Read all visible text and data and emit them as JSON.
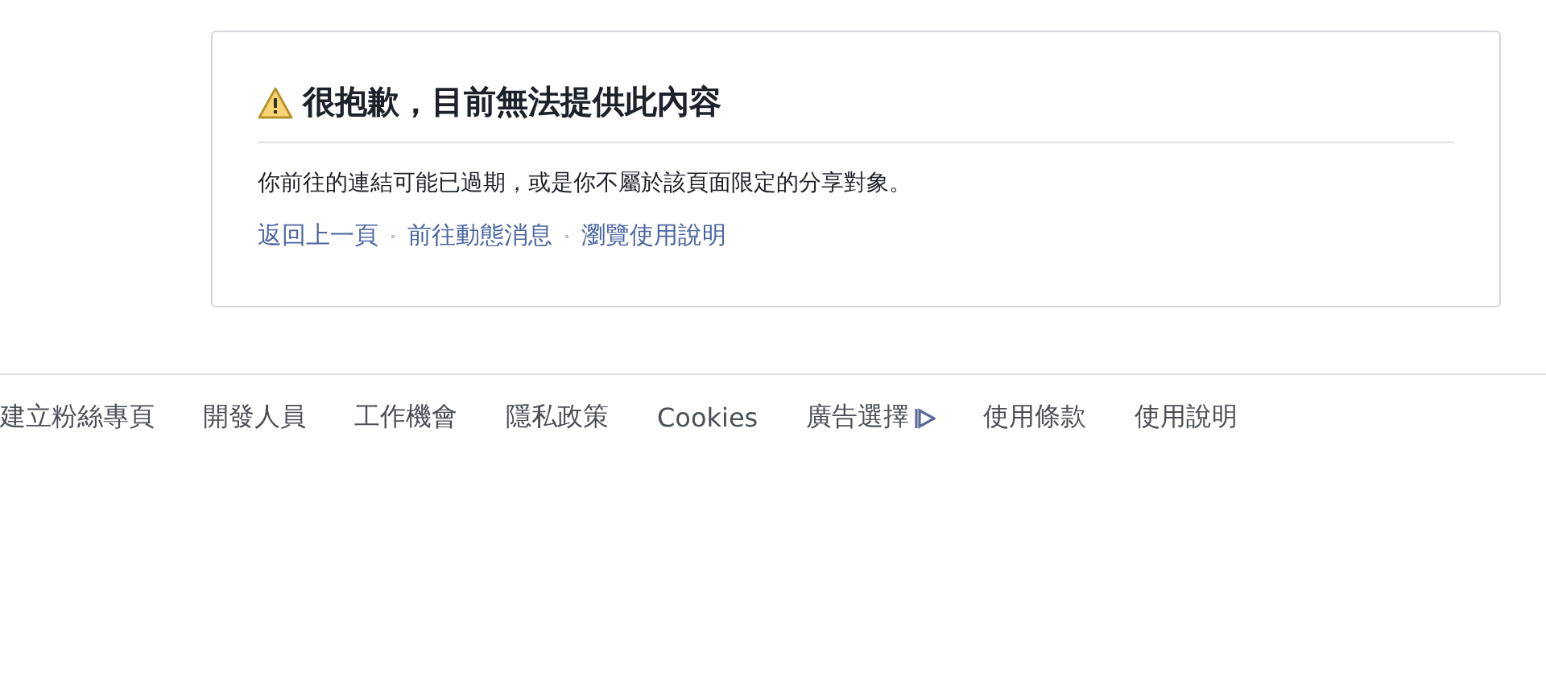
{
  "notice": {
    "title": "很抱歉，目前無法提供此內容",
    "message": "你前往的連結可能已過期，或是你不屬於該頁面限定的分享對象。",
    "links": [
      "返回上一頁",
      "前往動態消息",
      "瀏覽使用說明"
    ]
  },
  "footer": {
    "links": [
      {
        "label": "建立粉絲專頁",
        "kind": "text"
      },
      {
        "label": "開發人員",
        "kind": "text"
      },
      {
        "label": "工作機會",
        "kind": "text"
      },
      {
        "label": "隱私政策",
        "kind": "text"
      },
      {
        "label": "Cookies",
        "kind": "text"
      },
      {
        "label": "廣告選擇",
        "kind": "adchoices"
      },
      {
        "label": "使用條款",
        "kind": "text"
      },
      {
        "label": "使用說明",
        "kind": "text"
      }
    ]
  }
}
